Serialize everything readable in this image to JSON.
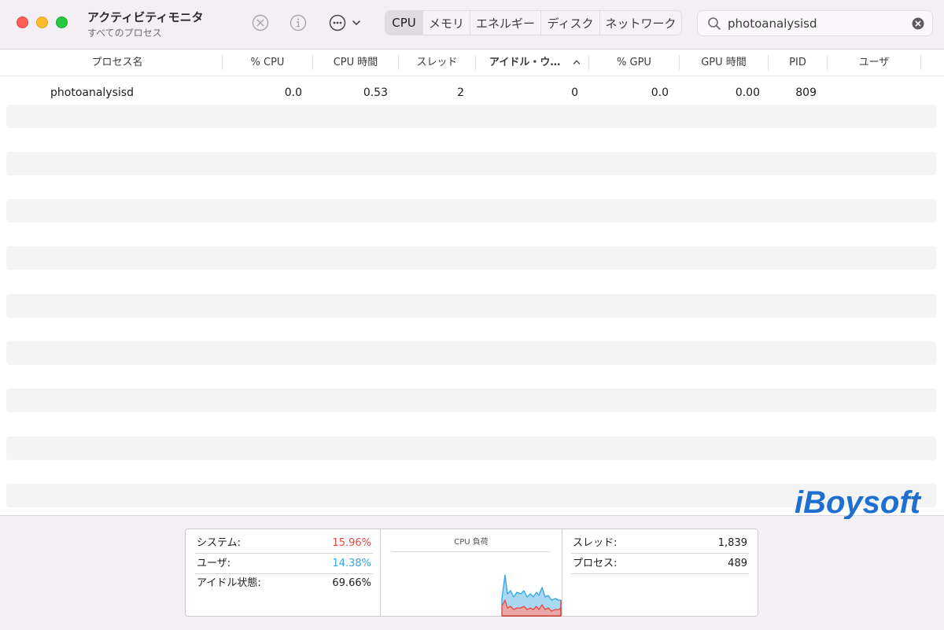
{
  "window": {
    "title": "アクティビティモニタ",
    "subtitle": "すべてのプロセス"
  },
  "toolbar": {
    "icons": [
      "stop-icon",
      "info-icon",
      "more-actions-icon"
    ],
    "tabs": [
      {
        "label": "CPU",
        "active": true
      },
      {
        "label": "メモリ",
        "active": false
      },
      {
        "label": "エネルギー",
        "active": false
      },
      {
        "label": "ディスク",
        "active": false
      },
      {
        "label": "ネットワーク",
        "active": false
      }
    ],
    "search": {
      "value": "photoanalysisd"
    }
  },
  "table": {
    "columns": [
      "プロセス名",
      "% CPU",
      "CPU 時間",
      "スレッド",
      "アイドル・ウ…",
      "% GPU",
      "GPU 時間",
      "PID",
      "ユーザ"
    ],
    "sorted_column": "アイドル・ウ…",
    "rows": [
      {
        "name": "photoanalysisd",
        "cpu": "0.0",
        "cpu_time": "0.53",
        "threads": "2",
        "idle_wakeups": "0",
        "gpu": "0.0",
        "gpu_time": "0.00",
        "pid": "809",
        "user": ""
      }
    ]
  },
  "summary": {
    "system_label": "システム:",
    "system_value": "15.96%",
    "user_label": "ユーザ:",
    "user_value": "14.38%",
    "idle_label": "アイドル状態:",
    "idle_value": "69.66%",
    "chart_title": "CPU 負荷",
    "threads_label": "スレッド:",
    "threads_value": "1,839",
    "processes_label": "プロセス:",
    "processes_value": "489"
  },
  "colors": {
    "system": "#e8463f",
    "user": "#31a8e6",
    "close": "#fe5f57",
    "minimize": "#febc2e",
    "zoom": "#28c840",
    "brand": "#1f6fd1"
  },
  "watermark": {
    "text": "iBoysoft"
  }
}
